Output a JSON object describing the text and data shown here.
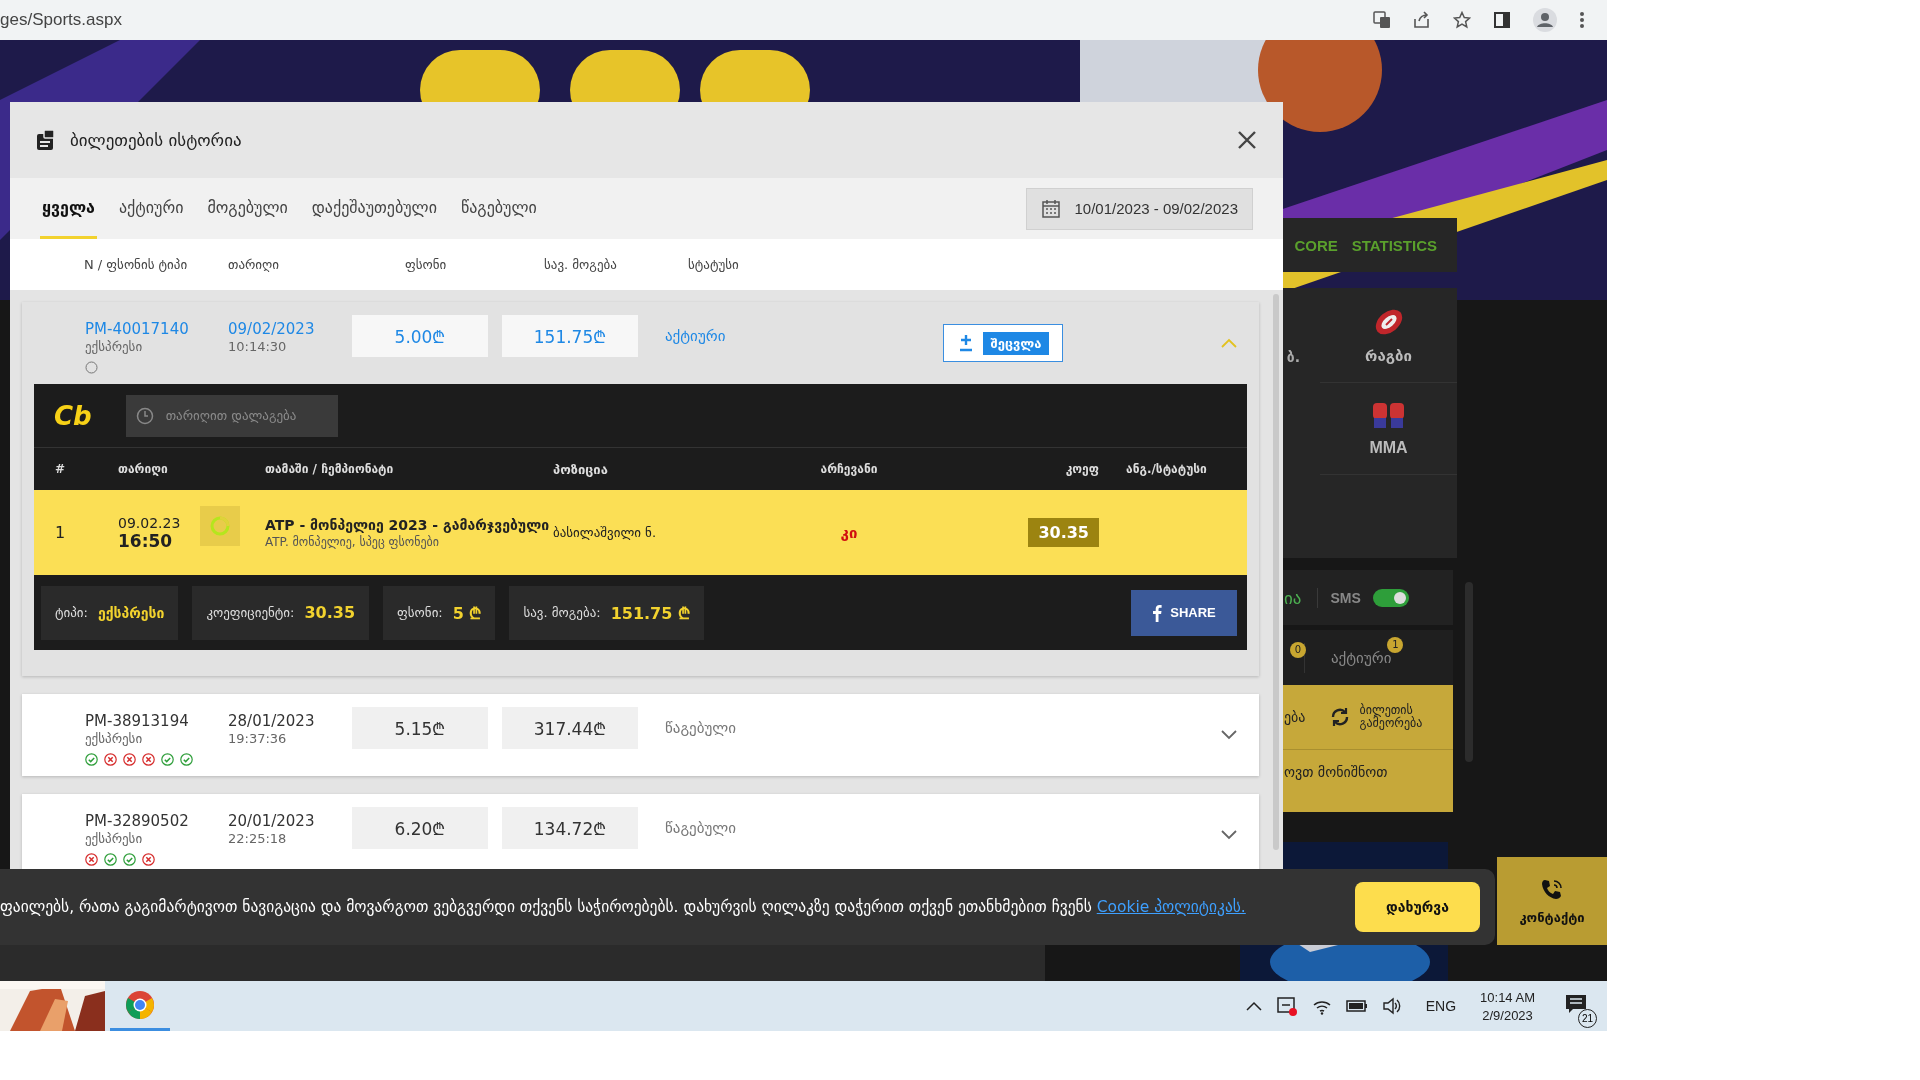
{
  "browser": {
    "url": "ges/Sports.aspx"
  },
  "modal": {
    "title": "ბილეთების ისტორია",
    "tabs": [
      {
        "label": "ყველა",
        "selected": true
      },
      {
        "label": "აქტიური",
        "selected": false
      },
      {
        "label": "მოგებული",
        "selected": false
      },
      {
        "label": "დაქეშაუთებული",
        "selected": false
      },
      {
        "label": "წაგებული",
        "selected": false
      }
    ],
    "date_range": "10/01/2023 - 09/02/2023",
    "columns": [
      "N / ფსონის ტიპი",
      "თარიღი",
      "ფსონი",
      "სავ. მოგება",
      "სტატუსი"
    ],
    "tickets": [
      {
        "id": "PM-40017140",
        "type": "ექსპრესი",
        "date": "09/02/2023",
        "time": "10:14:30",
        "stake": "5.00₾",
        "win": "151.75₾",
        "status": "აქტიური",
        "active": true,
        "expanded": true,
        "edit_button": "შეცვლა",
        "results": [
          {
            "kind": "pending"
          }
        ],
        "detail": {
          "logo": "Cb",
          "sort_button": "თარიღით დალაგება",
          "columns": [
            "#",
            "თარიღი",
            "თამაში / ჩემპიონატი",
            "პოზიცია",
            "არჩევანი",
            "კოეფ",
            "ანგ./სტატუსი"
          ],
          "rows": [
            {
              "index": "1",
              "date": "09.02.23",
              "time": "16:50",
              "event": "ATP - მონპელიე 2023 - გამარჯვებული",
              "league": "ATP. მონპელიე, სპეც ფსონები",
              "position": "ბასილაშვილი ნ.",
              "pick": "კი",
              "odds": "30.35"
            }
          ],
          "summary": [
            {
              "label": "ტიპი:",
              "value": "ექსპრესი"
            },
            {
              "label": "კოეფიციენტი:",
              "value": "30.35"
            },
            {
              "label": "ფსონი:",
              "value": "5 ₾"
            },
            {
              "label": "სავ. მოგება:",
              "value": "151.75 ₾"
            }
          ],
          "share_button": "SHARE"
        }
      },
      {
        "id": "PM-38913194",
        "type": "ექსპრესი",
        "date": "28/01/2023",
        "time": "19:37:36",
        "stake": "5.15₾",
        "win": "317.44₾",
        "status": "წაგებული",
        "active": false,
        "expanded": false,
        "results": [
          {
            "kind": "won"
          },
          {
            "kind": "lost"
          },
          {
            "kind": "lost"
          },
          {
            "kind": "lost"
          },
          {
            "kind": "won"
          },
          {
            "kind": "won"
          }
        ]
      },
      {
        "id": "PM-32890502",
        "type": "ექსპრესი",
        "date": "20/01/2023",
        "time": "22:25:18",
        "stake": "6.20₾",
        "win": "134.72₾",
        "status": "წაგებული",
        "active": false,
        "expanded": false,
        "results": [
          {
            "kind": "lost"
          },
          {
            "kind": "won"
          },
          {
            "kind": "won"
          },
          {
            "kind": "lost"
          }
        ]
      }
    ]
  },
  "sidebar": {
    "stats_tabs": [
      "CORE",
      "STATISTICS"
    ],
    "sports": [
      {
        "label": "ბ.",
        "kind": "text"
      },
      {
        "label": "რაგბი",
        "kind": "rugby"
      },
      {
        "label": "MMA",
        "kind": "mma"
      }
    ],
    "sms": {
      "fragment": "ია",
      "label": "SMS",
      "on": true
    },
    "bet_tabs": [
      {
        "count": "0"
      },
      {
        "label": "აქტიური",
        "count": "1"
      }
    ],
    "repeat": {
      "fragment": "ება",
      "button": "ბილეთის გამეორება",
      "note": "ოვთ მონიშნოთ"
    }
  },
  "cookie": {
    "text": "ფაილებს, რათა გაგიმარტივოთ ნავიგაცია და მოვარგოთ ვებგვერდი თქვენს საჭიროებებს. დახურვის ღილაკზე დაჭერით თქვენ ეთანხმებით ჩვენს",
    "link": "Cookie პოლიტიკას.",
    "close_button": "დახურვა"
  },
  "contact": "კონტაქტი",
  "taskbar": {
    "lang": "ENG",
    "time": "10:14 AM",
    "date": "2/9/2023",
    "notifications": "21"
  }
}
